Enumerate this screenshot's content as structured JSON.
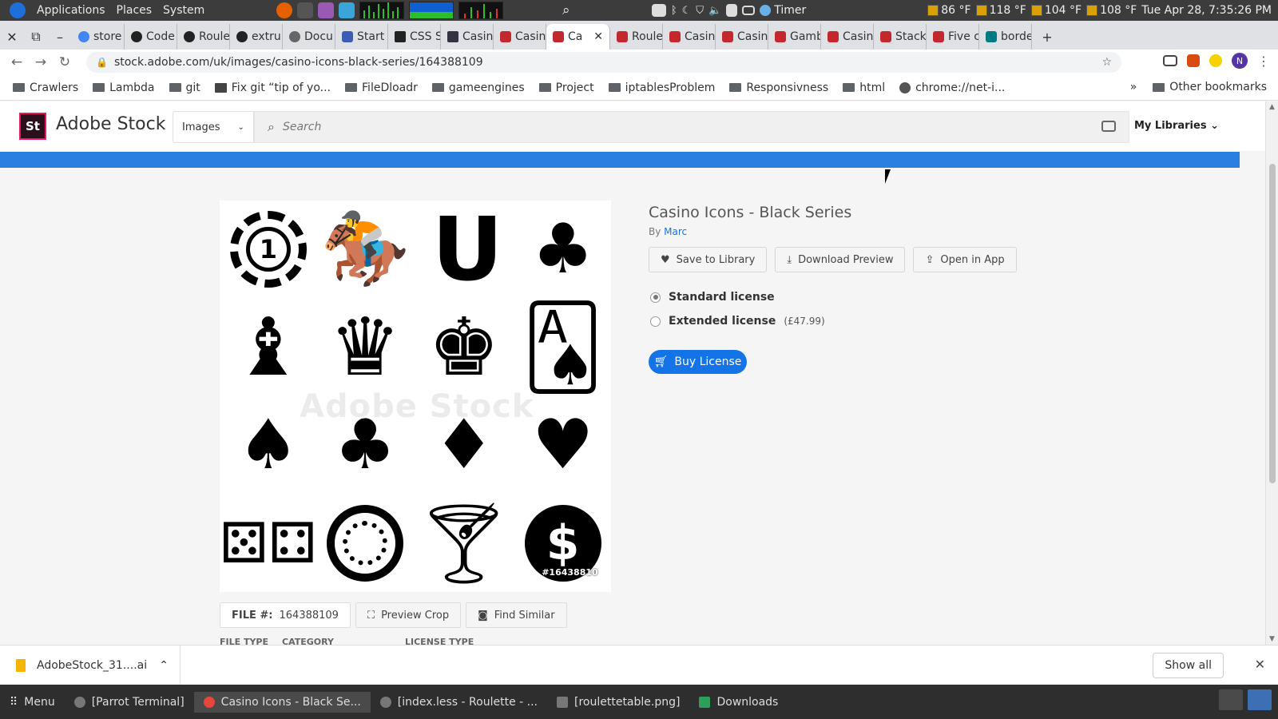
{
  "system_bar": {
    "menus": [
      "Applications",
      "Places",
      "System"
    ],
    "timer_label": "Timer",
    "temps": [
      "86 °F",
      "118 °F",
      "104 °F",
      "108 °F"
    ],
    "clock": "Tue Apr 28, 7:35:26 PM"
  },
  "tabs": [
    {
      "label": "store",
      "favicon": "google-icon"
    },
    {
      "label": "Code",
      "favicon": "codepen-icon"
    },
    {
      "label": "Roule",
      "favicon": "codepen-icon"
    },
    {
      "label": "extru",
      "favicon": "github-icon"
    },
    {
      "label": "Docu",
      "favicon": "globe-icon"
    },
    {
      "label": "Start",
      "favicon": "bar-icon"
    },
    {
      "label": "CSS S",
      "favicon": "css-icon"
    },
    {
      "label": "Casin",
      "favicon": "v-icon"
    },
    {
      "label": "Casin",
      "favicon": "adobe-stock-icon"
    },
    {
      "label": "Ca",
      "favicon": "adobe-stock-icon",
      "active": true
    },
    {
      "label": "Roule",
      "favicon": "adobe-stock-icon"
    },
    {
      "label": "Casin",
      "favicon": "adobe-stock-icon"
    },
    {
      "label": "Casin",
      "favicon": "adobe-stock-icon"
    },
    {
      "label": "Gamb",
      "favicon": "adobe-stock-icon"
    },
    {
      "label": "Casin",
      "favicon": "adobe-stock-icon"
    },
    {
      "label": "Stack",
      "favicon": "adobe-stock-icon"
    },
    {
      "label": "Five c",
      "favicon": "adobe-stock-icon"
    },
    {
      "label": "borde",
      "favicon": "teal-icon"
    }
  ],
  "address": {
    "url": "stock.adobe.com/uk/images/casino-icons-black-series/164388109",
    "profile_initial": "N"
  },
  "bookmarks": [
    "Crawlers",
    "Lambda",
    "git",
    "Fix git “tip of yo...",
    "FileDloadr",
    "gameengines",
    "Project",
    "iptablesProblem",
    "Responsivness",
    "html",
    "chrome://net-i..."
  ],
  "bookmarks_more": "»",
  "other_bookmarks": "Other bookmarks",
  "stock": {
    "logo_text": "St",
    "brand": "Adobe Stock",
    "type_select": "Images",
    "search_placeholder": "Search",
    "my_libraries": "My Libraries"
  },
  "asset": {
    "title": "Casino Icons - Black Series",
    "by": "By",
    "author": "Marc",
    "watermark": "Adobe Stock",
    "overlay_id": "#16438810",
    "coin_number": "1",
    "dollar_symbol": "$"
  },
  "actions": {
    "save": "Save to Library",
    "download": "Download Preview",
    "open": "Open in App"
  },
  "licenses": [
    {
      "label": "Standard license",
      "price": "",
      "selected": true
    },
    {
      "label": "Extended license",
      "price": "(£47.99)",
      "selected": false
    }
  ],
  "buy_label": "Buy License",
  "file_row": {
    "file_prefix": "FILE #:",
    "file_number": "164388109",
    "preview_crop": "Preview Crop",
    "find_similar": "Find Similar"
  },
  "meta_headers": [
    "FILE TYPE",
    "CATEGORY",
    "LICENSE TYPE"
  ],
  "download_bar": {
    "file": "AdobeStock_31....ai",
    "show_all": "Show all"
  },
  "taskbar": {
    "menu": "Menu",
    "tasks": [
      "[Parrot Terminal]",
      "Casino Icons - Black Se...",
      "[index.less - Roulette - ...",
      "[roulettetable.png]",
      "Downloads"
    ],
    "active_index": 1
  },
  "colors": {
    "accent": "#1473e6",
    "bluebar": "#2b7fe0",
    "stock_brand": "#e81a63"
  }
}
